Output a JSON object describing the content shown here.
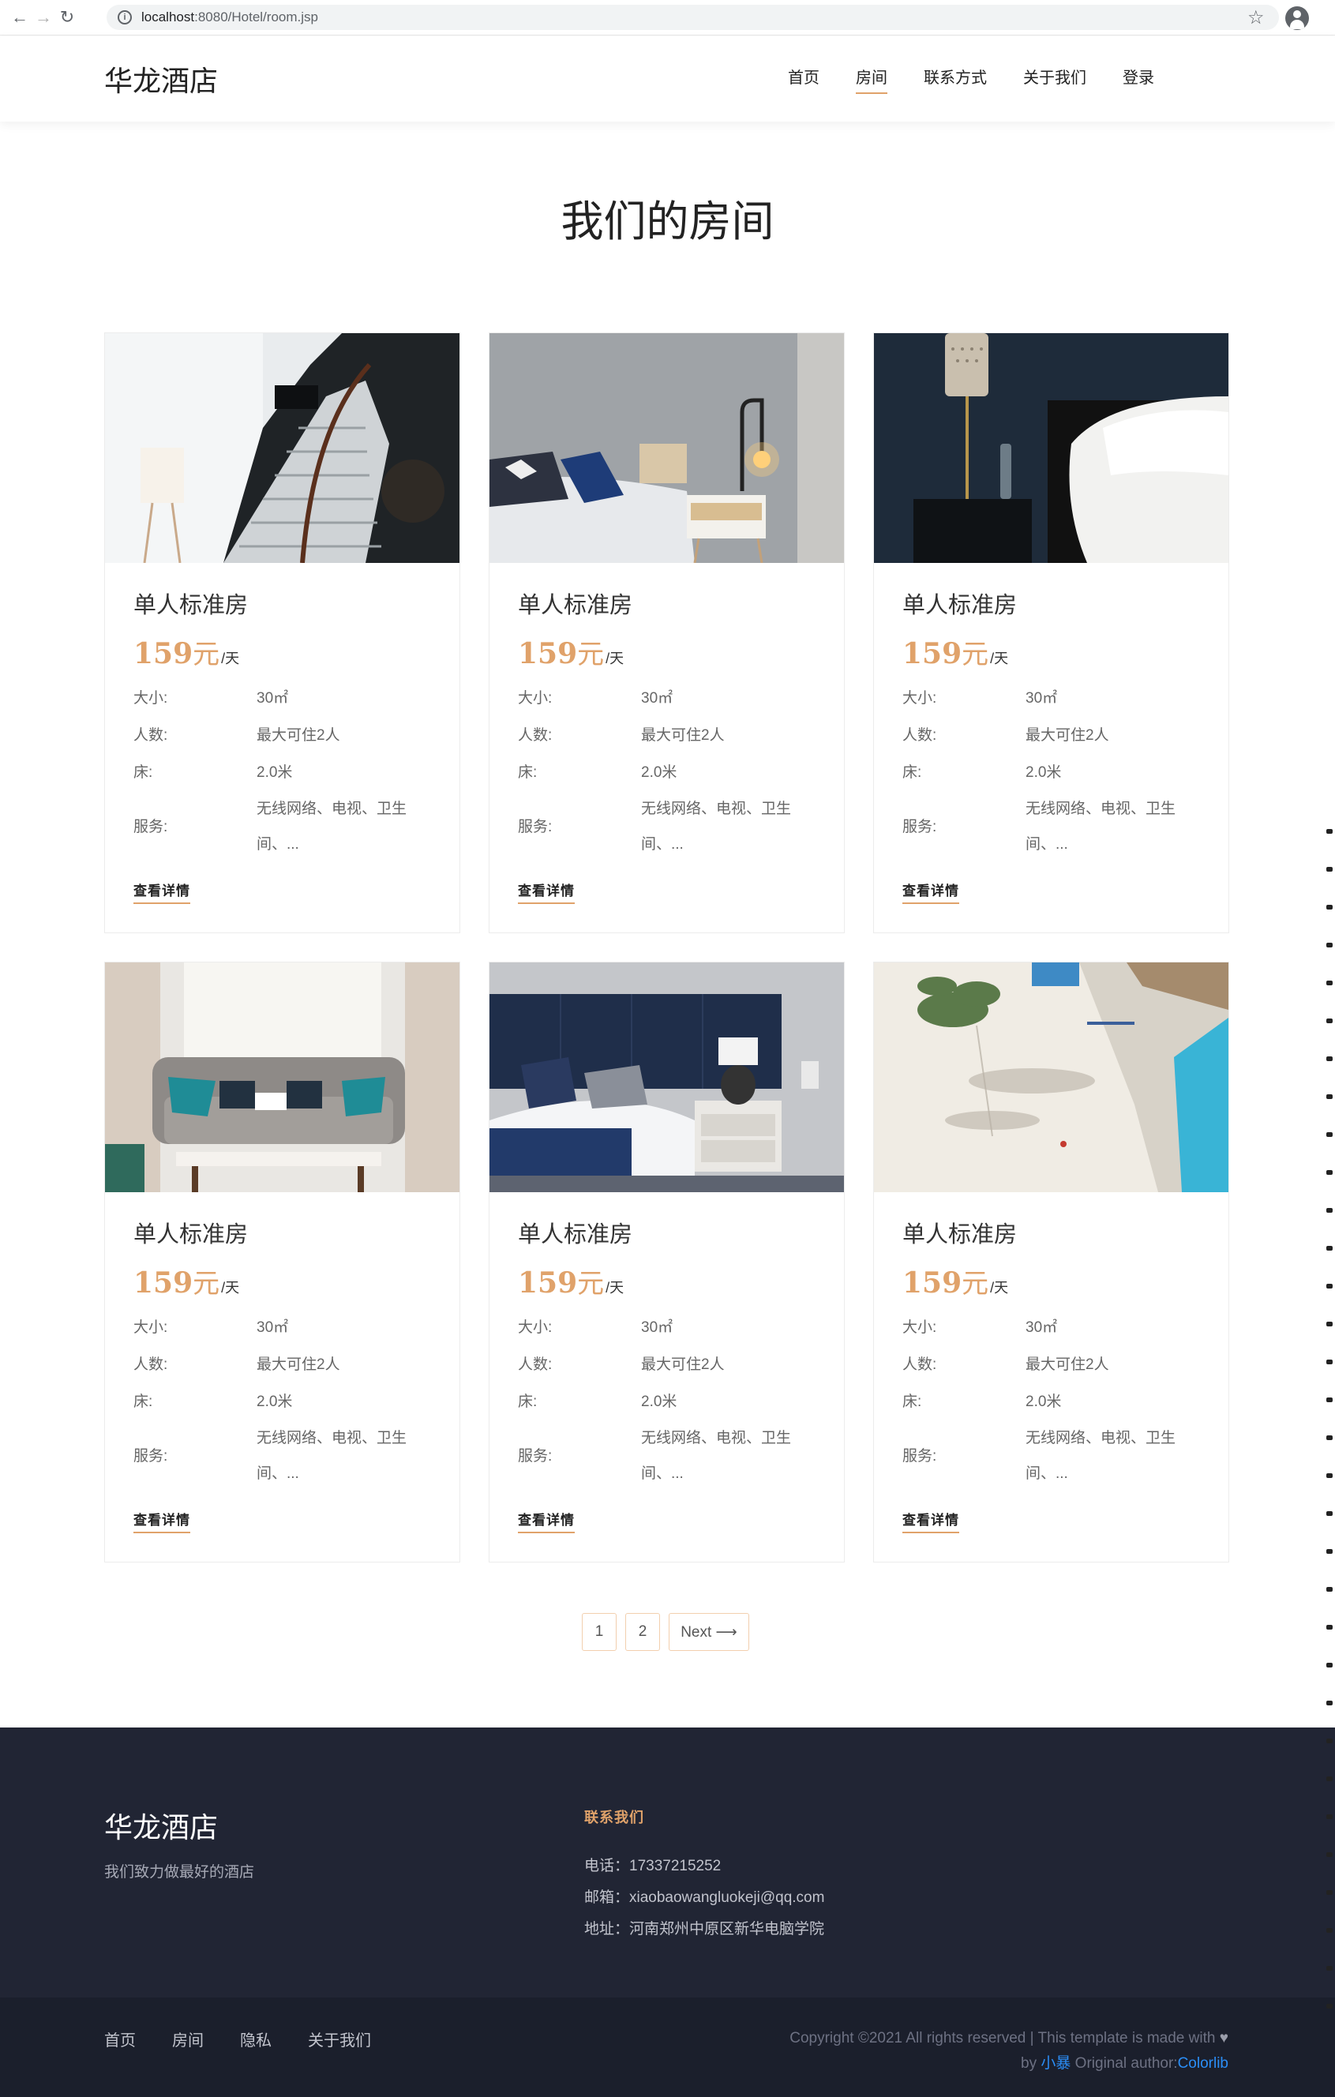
{
  "browser": {
    "url_host": "localhost",
    "url_path": ":8080/Hotel/room.jsp"
  },
  "header": {
    "logo": "华龙酒店",
    "nav": [
      {
        "label": "首页"
      },
      {
        "label": "房间",
        "active": true
      },
      {
        "label": "联系方式"
      },
      {
        "label": "关于我们"
      },
      {
        "label": "登录"
      }
    ]
  },
  "page_title": "我们的房间",
  "spec_labels": {
    "size": "大小:",
    "people": "人数:",
    "bed": "床:",
    "service": "服务:"
  },
  "rooms": [
    {
      "name": "单人标准房",
      "price": "159",
      "currency": "元",
      "per": "/天",
      "size": "30㎡",
      "people": "最大可住2人",
      "bed": "2.0米",
      "service": "无线网络、电视、卫生间、...",
      "detail": "查看详情",
      "photo": "staircase"
    },
    {
      "name": "单人标准房",
      "price": "159",
      "currency": "元",
      "per": "/天",
      "size": "30㎡",
      "people": "最大可住2人",
      "bed": "2.0米",
      "service": "无线网络、电视、卫生间、...",
      "detail": "查看详情",
      "photo": "bed-lamp"
    },
    {
      "name": "单人标准房",
      "price": "159",
      "currency": "元",
      "per": "/天",
      "size": "30㎡",
      "people": "最大可住2人",
      "bed": "2.0米",
      "service": "无线网络、电视、卫生间、...",
      "detail": "查看详情",
      "photo": "dark-bedroom"
    },
    {
      "name": "单人标准房",
      "price": "159",
      "currency": "元",
      "per": "/天",
      "size": "30㎡",
      "people": "最大可住2人",
      "bed": "2.0米",
      "service": "无线网络、电视、卫生间、...",
      "detail": "查看详情",
      "photo": "sofa-living-room"
    },
    {
      "name": "单人标准房",
      "price": "159",
      "currency": "元",
      "per": "/天",
      "size": "30㎡",
      "people": "最大可住2人",
      "bed": "2.0米",
      "service": "无线网络、电视、卫生间、...",
      "detail": "查看详情",
      "photo": "navy-bedroom"
    },
    {
      "name": "单人标准房",
      "price": "159",
      "currency": "元",
      "per": "/天",
      "size": "30㎡",
      "people": "最大可住2人",
      "bed": "2.0米",
      "service": "无线网络、电视、卫生间、...",
      "detail": "查看详情",
      "photo": "beach-aerial"
    }
  ],
  "pagination": {
    "pages": [
      "1",
      "2"
    ],
    "next": "Next ⟶"
  },
  "footer": {
    "logo": "华龙酒店",
    "tagline": "我们致力做最好的酒店",
    "contact_heading": "联系我们",
    "phone": "电话：17337215252",
    "email": "邮箱：xiaobaowangluokeji@qq.com",
    "address": "地址：河南郑州中原区新华电脑学院",
    "nav": [
      "首页",
      "房间",
      "隐私",
      "关于我们"
    ],
    "copyright_line1": "Copyright ©2021 All rights reserved | This template is made with",
    "by": "by",
    "author_name": "小暴",
    "original_author": "Original author:",
    "colorlib": "Colorlib"
  },
  "colors": {
    "accent": "#e0a26a",
    "footer_bg": "#212534",
    "footer_bottom_bg": "#1b1f2c",
    "link_blue": "#2b8ef7"
  }
}
